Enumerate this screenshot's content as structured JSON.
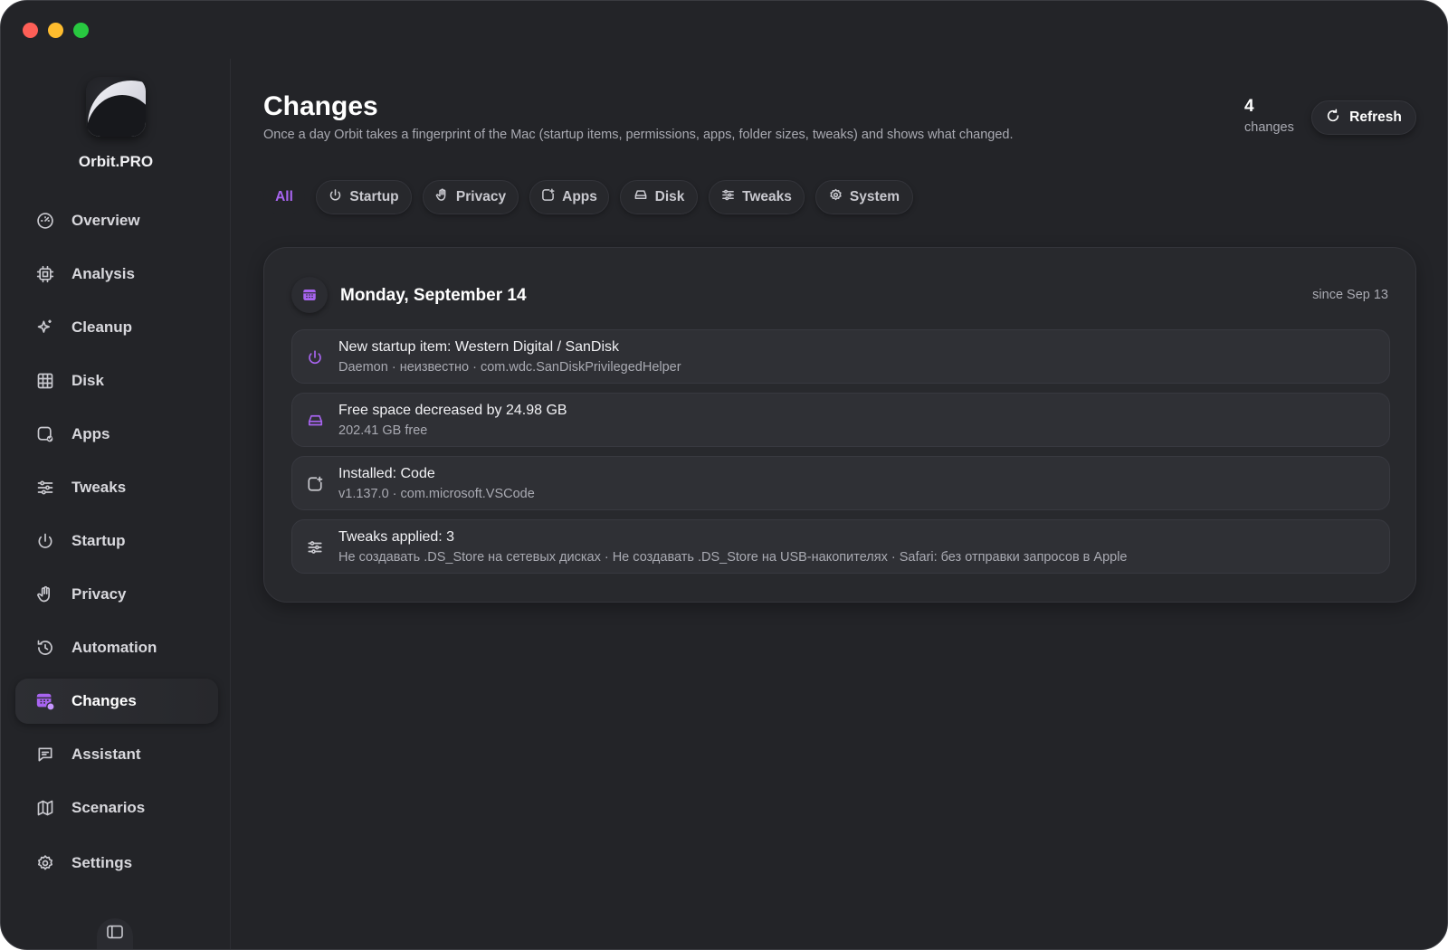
{
  "window": {
    "controls": [
      "close",
      "minimize",
      "zoom"
    ]
  },
  "brand": {
    "name": "Orbit.PRO",
    "logo_icon": "orbit-logo-icon"
  },
  "sidebar": {
    "items": [
      {
        "label": "Overview",
        "icon": "gauge-icon"
      },
      {
        "label": "Analysis",
        "icon": "chip-icon"
      },
      {
        "label": "Cleanup",
        "icon": "sparkle-icon"
      },
      {
        "label": "Disk",
        "icon": "grid-icon"
      },
      {
        "label": "Apps",
        "icon": "app-check-icon"
      },
      {
        "label": "Tweaks",
        "icon": "sliders-icon"
      },
      {
        "label": "Startup",
        "icon": "power-icon"
      },
      {
        "label": "Privacy",
        "icon": "hand-icon"
      },
      {
        "label": "Automation",
        "icon": "history-icon"
      },
      {
        "label": "Changes",
        "icon": "calendar-badge-icon",
        "active": true
      },
      {
        "label": "Assistant",
        "icon": "chat-icon"
      },
      {
        "label": "Scenarios",
        "icon": "map-icon"
      },
      {
        "label": "Settings",
        "icon": "gear-icon"
      }
    ],
    "collapse_icon": "sidebar-toggle-icon"
  },
  "header": {
    "title": "Changes",
    "subtitle": "Once a day Orbit takes a fingerprint of the Mac (startup items, permissions, apps, folder sizes, tweaks) and shows what changed.",
    "count": "4",
    "count_label": "changes",
    "refresh_label": "Refresh"
  },
  "filters": [
    {
      "label": "All",
      "active": true
    },
    {
      "label": "Startup",
      "icon": "power-icon"
    },
    {
      "label": "Privacy",
      "icon": "hand-icon"
    },
    {
      "label": "Apps",
      "icon": "app-plus-icon"
    },
    {
      "label": "Disk",
      "icon": "drive-icon"
    },
    {
      "label": "Tweaks",
      "icon": "sliders-icon"
    },
    {
      "label": "System",
      "icon": "gear-icon"
    }
  ],
  "day": {
    "title": "Monday, September 14",
    "since": "since Sep 13",
    "changes": [
      {
        "title": "New startup item: Western Digital / SanDisk",
        "subtitle": "Daemon · неизвестно · com.wdc.SanDiskPrivilegedHelper",
        "icon": "power-icon"
      },
      {
        "title": "Free space decreased by 24.98 GB",
        "subtitle": "202.41 GB free",
        "icon": "drive-icon"
      },
      {
        "title": "Installed: Code",
        "subtitle": "v1.137.0 · com.microsoft.VSCode",
        "icon": "app-plus-icon"
      },
      {
        "title": "Tweaks applied: 3",
        "subtitle": "Не создавать .DS_Store на сетевых дисках · Не создавать .DS_Store на USB-накопителях · Safari: без отправки запросов в Apple",
        "icon": "sliders-icon"
      }
    ]
  },
  "colors": {
    "accent": "#a864f0",
    "background": "#232428",
    "card": "#28292d",
    "row": "#2f3035"
  }
}
